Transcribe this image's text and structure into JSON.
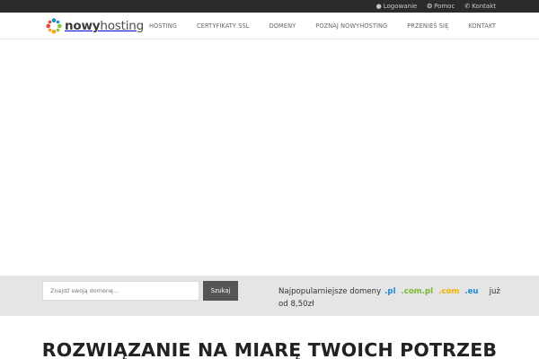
{
  "topbar": {
    "login": "Logowanie",
    "help": "Pomoc",
    "contact": "Kontakt"
  },
  "brand": {
    "name_bold": "nowy",
    "name_light": "hosting",
    "logo_colors": [
      "#1f8fd6",
      "#8cc63f",
      "#f6a623",
      "#e84c3d"
    ]
  },
  "nav": {
    "items": [
      {
        "label": "HOSTING"
      },
      {
        "label": "CERTYFIKATY SSL"
      },
      {
        "label": "DOMENY"
      },
      {
        "label": "POZNAJ NOWYHOSTING"
      },
      {
        "label": "PRZENIEŚ SIĘ"
      },
      {
        "label": "KONTAKT"
      }
    ]
  },
  "domain_search": {
    "placeholder": "Znajdź swoją domenę...",
    "button": "Szukaj",
    "popular_label": "Najpopularniejsze domeny",
    "extensions": [
      {
        "label": ".pl",
        "color": "#1e88d6"
      },
      {
        "label": ".com.pl",
        "color": "#7cb82f"
      },
      {
        "label": ".com",
        "color": "#f0b400"
      },
      {
        "label": ".eu",
        "color": "#1e88d6"
      }
    ],
    "price_text": "już od 8,50zł"
  },
  "headline": {
    "regular": "ROZWIĄZANIE NA MIARĘ",
    "bold": "TWOICH POTRZEB"
  }
}
